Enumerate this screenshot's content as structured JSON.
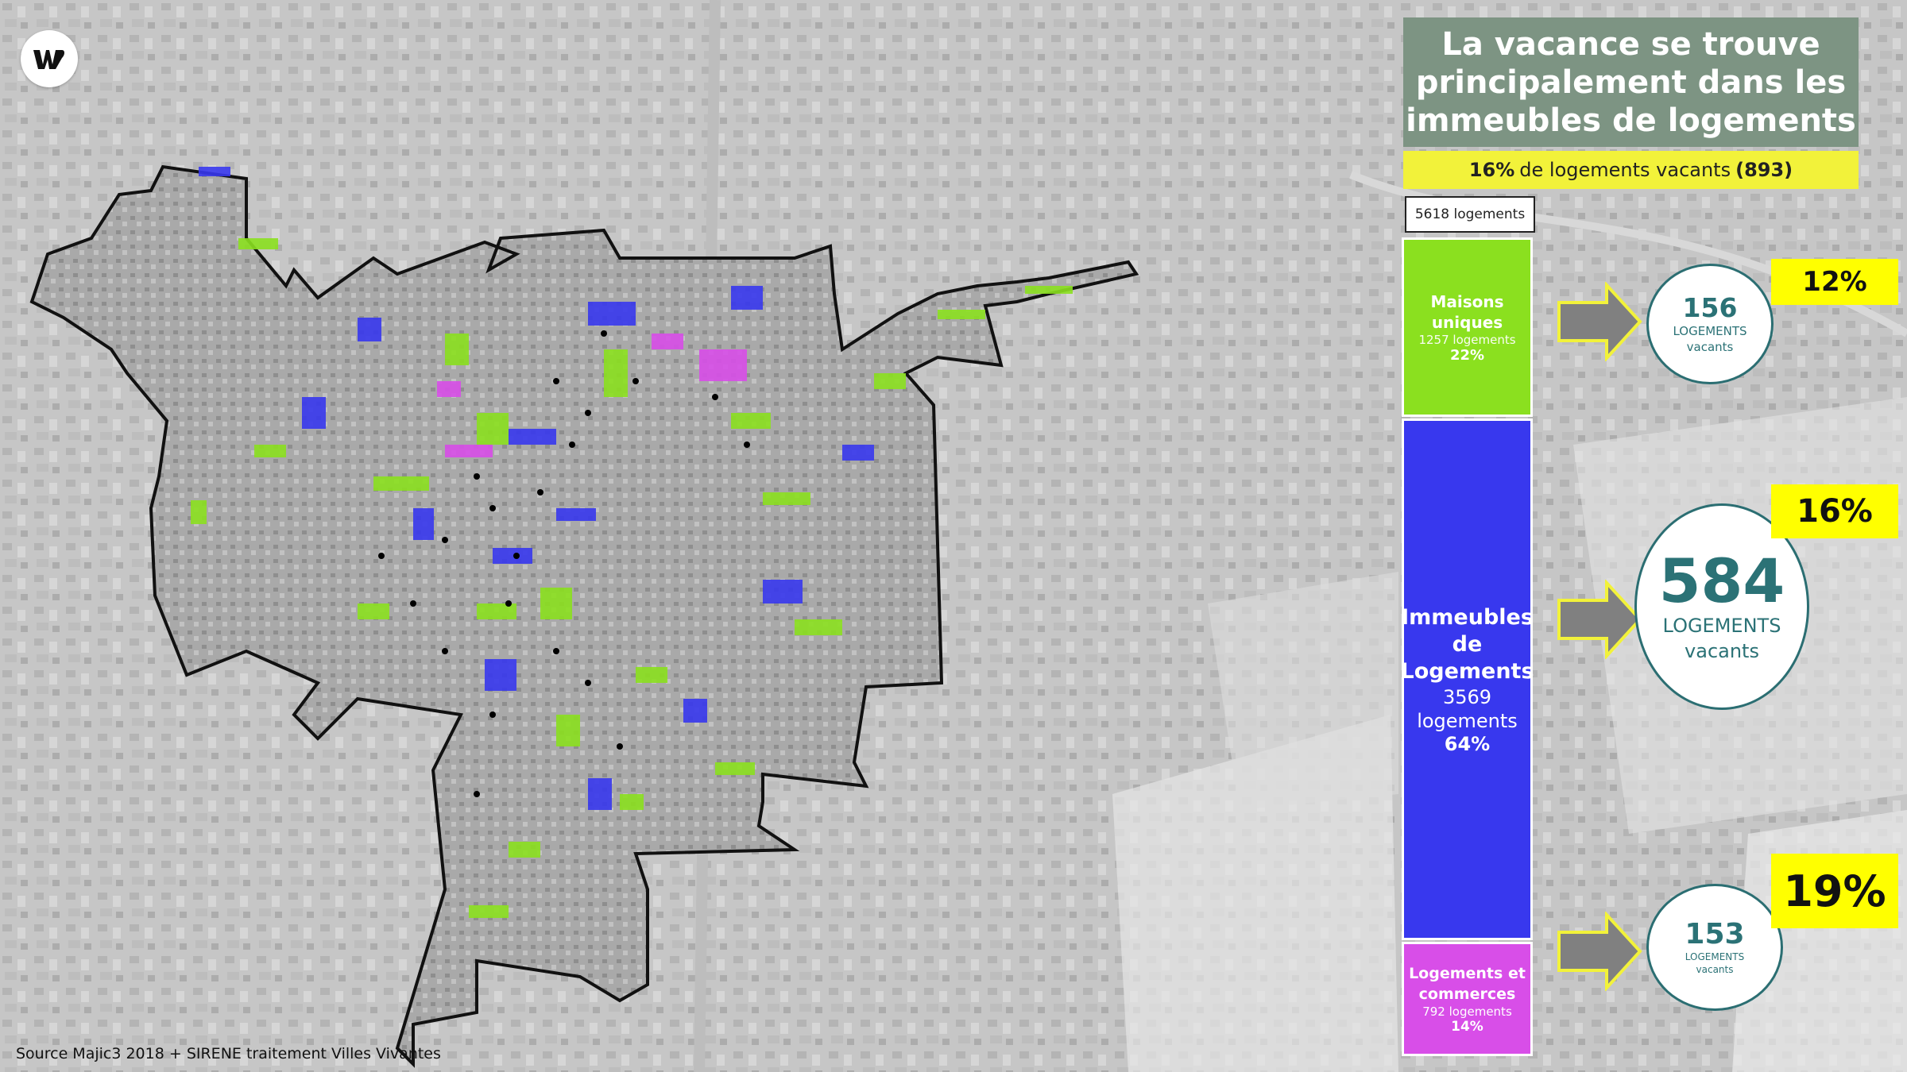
{
  "title": "La vacance se trouve principalement dans les immeubles de logements",
  "banner": {
    "pct": "16%",
    "text": "de logements vacants",
    "count": "(893)"
  },
  "total": "5618 logements",
  "source": "Source Majic3 2018 + SIRENE traitement Villes Vivantes",
  "colors": {
    "maisons": "#8be01f",
    "immeubles": "#3838ee",
    "commerces": "#d84ee8",
    "title_bg": "#7d9483",
    "highlight": "#ffff00",
    "circle_text": "#2b7276"
  },
  "segments": [
    {
      "name_1": "Maisons",
      "name_2": "uniques",
      "count": "1257 logements",
      "pct": "22%"
    },
    {
      "name_1": "Immeubles",
      "name_2": "de",
      "name_3": "Logements",
      "count_1": "3569",
      "count_2": "logements",
      "pct": "64%"
    },
    {
      "name_1": "Logements et",
      "name_2": "commerces",
      "count": "792 logements",
      "pct": "14%"
    }
  ],
  "circles": [
    {
      "num": "156",
      "label_1": "LOGEMENTS",
      "label_2": "vacants"
    },
    {
      "num": "584",
      "label_1": "LOGEMENTS",
      "label_2": "vacants"
    },
    {
      "num": "153",
      "label_1": "LOGEMENTS",
      "label_2": "vacants"
    }
  ],
  "rates": [
    "12%",
    "16%",
    "19%"
  ]
}
